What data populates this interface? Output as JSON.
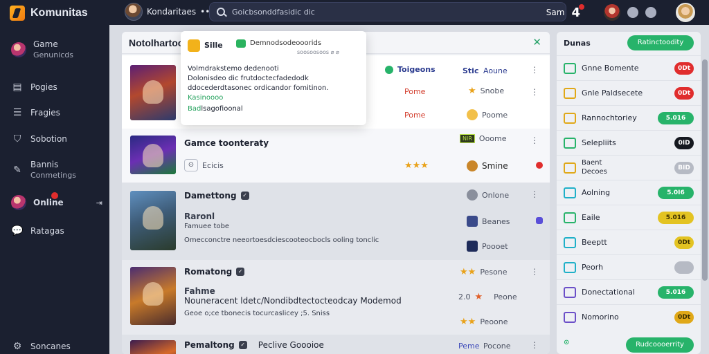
{
  "brand": {
    "name": "Komunitas"
  },
  "topbar": {
    "user_name": "Kondaritaes",
    "user_suffix": "•••",
    "search_placeholder": "Goicbsonddfasidic dic",
    "right_label": "Sam",
    "right_count": "4"
  },
  "sidebar": {
    "items": [
      {
        "label": "Game",
        "sub": "Genunicds"
      },
      {
        "label": "Pogies"
      },
      {
        "label": "Fragies"
      },
      {
        "label": "Sobotion"
      },
      {
        "label": "Bannis",
        "sub": "Conmetings"
      },
      {
        "label": "Online"
      },
      {
        "label": "Ratagas"
      },
      {
        "label": "Soncanes"
      }
    ]
  },
  "main": {
    "title": "Notolhartoon",
    "close": "✕",
    "popover": {
      "title": "Sille",
      "heading": "Demnodsodeooorids",
      "sub": "soosoosoos ⌀ ⌀",
      "lines": [
        "Volmdrakstemo dedenooti",
        "Dolonisdeo dic frutdoctecfadedodk",
        "ddocederdtasonec ordicandor fomitinon.",
        "Kasinoooo"
      ],
      "foot_label": "Bad",
      "foot_rest": "lsagofioonal"
    },
    "row1": {
      "status_a": "Toigeons",
      "status_b": "Stic",
      "status_c": "Aoune",
      "cell_a": "Pome",
      "cell_b": "Snobe",
      "cell_c": "Pome",
      "cell_d": "Poome"
    },
    "row2": {
      "title": "Gamce toonteraty",
      "action": "Ecicis",
      "stars": "★★★",
      "cell_a": "Ooome",
      "cell_b": "Smine",
      "tile_text": "NIR"
    },
    "row3": {
      "title": "Damettong",
      "subtitle": "Raronl",
      "line1": "Famuee tobe",
      "line2": "Omecconctre neeortoesdciescooteocbocls ooling tonclic",
      "cell_a": "Onlone",
      "cell_b": "Beanes",
      "cell_c": "Poooet"
    },
    "row4": {
      "title": "Romatong",
      "subtitle": "Fahme",
      "line1": "Nouneracent ldetc/Nondibdtectocteodcay Modemod",
      "line2": "Geoe o;ce tbonecis tocurcaslicey ;5. Sniss",
      "cell_a": "Pesone",
      "rating": "2.0",
      "cell_b": "Peone",
      "cell_c": "Peoone"
    },
    "row5": {
      "title": "Pemaltong",
      "mid": "Peclive Goooioe",
      "status": "Peme",
      "cell": "Pocone"
    }
  },
  "right": {
    "title": "Dunas",
    "button": "Ratinctoodity",
    "rows": [
      {
        "label": "Gnne Bomente",
        "pill": "0Dt",
        "pill_color": "#e02d2d"
      },
      {
        "label": "Gnle Paldsecete",
        "pill": "0Dt",
        "pill_color": "#e02d2d"
      },
      {
        "label": "Rannochtoriey",
        "pill": "5.016",
        "pill_color": "#27b36a"
      },
      {
        "label": "Selepliits",
        "pill": "0ID",
        "pill_color": "#15181f"
      },
      {
        "label": "Baent",
        "label2": "Decoes",
        "pill": "BID",
        "pill_color": "#b6bac4"
      },
      {
        "label": "Aolning",
        "pill": "5.0I6",
        "pill_color": "#27b36a"
      },
      {
        "label": "Eaile",
        "pill": "5.016",
        "pill_color": "#e3c322"
      },
      {
        "label": "Beeptt",
        "pill": "0Dt",
        "pill_color": "#e3c322"
      },
      {
        "label": "Peorh",
        "pill": "",
        "pill_color": "#b6bac4"
      },
      {
        "label": "Donectational",
        "pill": "5.016",
        "pill_color": "#27b36a"
      },
      {
        "label": "Nomorino",
        "pill": "0Dt",
        "pill_color": "#e0a818"
      }
    ],
    "footer_button": "Rudcoooerrity"
  },
  "colors": {
    "accent": "#27b36a",
    "sidebar_bg": "#1b2030",
    "alert": "#e02d2d",
    "star": "#e9a21a"
  },
  "icons": [
    "search-icon",
    "bell-icon",
    "shield-icon",
    "chat-icon",
    "users-icon",
    "check-icon",
    "star-icon",
    "kebab-icon",
    "close-icon"
  ]
}
